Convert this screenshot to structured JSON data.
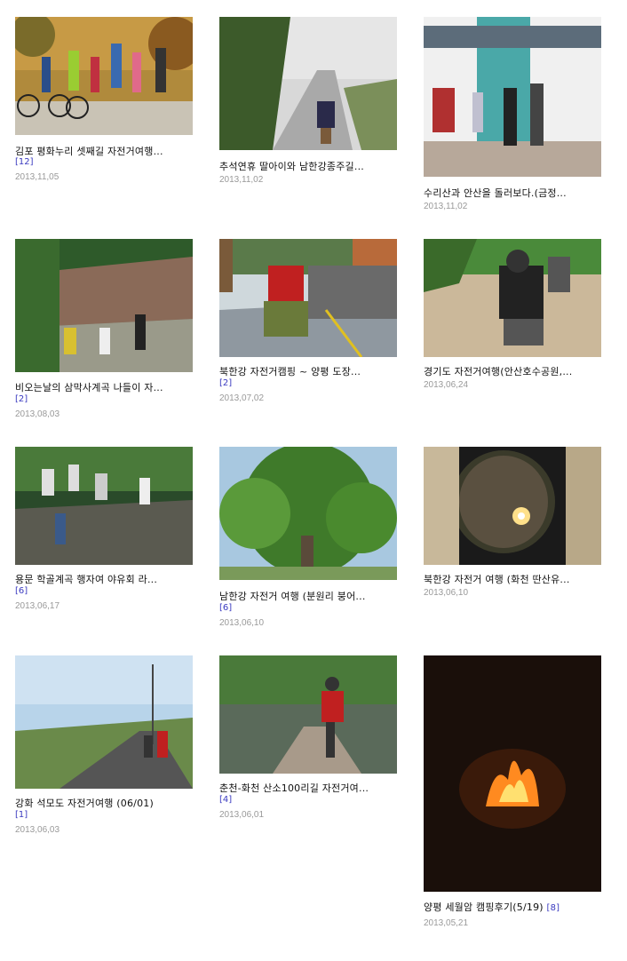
{
  "posts": [
    {
      "title": "김포 평화누리 셋째길 자전거여행...",
      "count": "[12]",
      "date": "2013,11,05"
    },
    {
      "title": "추석연휴 딸아이와 남한강종주길...",
      "count": "",
      "date": "2013,11,02"
    },
    {
      "title": "수리산과 안산을 돌러보다.(금정...",
      "count": "",
      "date": "2013,11,02"
    },
    {
      "title": "비오는날의 삼막사계곡 나들이 자...",
      "count": "[2]",
      "date": "2013,08,03"
    },
    {
      "title": "북한강 자전거캠핑 ~ 양평 도장...",
      "count": "[2]",
      "date": "2013,07,02"
    },
    {
      "title": "경기도 자전거여행(안산호수공원,...",
      "count": "",
      "date": "2013,06,24"
    },
    {
      "title": "용문 학골계곡 행자여 야유회 라...",
      "count": "[6]",
      "date": "2013,06,17"
    },
    {
      "title": "남한강 자전거 여행 (분원리 붕어...",
      "count": "[6]",
      "date": "2013,06,10"
    },
    {
      "title": "북한강 자전거 여행 (화천 딴산유...",
      "count": "",
      "date": "2013,06,10"
    },
    {
      "title": "강화 석모도 자전거여행 (06/01)",
      "count": "[1]",
      "date": "2013,06,03"
    },
    {
      "title": "춘천-화천 산소100리길 자전거여...",
      "count": "[4]",
      "date": "2013,06,01"
    },
    {
      "title": "양평 세월암 캠핑후기(5/19)",
      "count": "[8]",
      "date": "2013,05,21"
    }
  ]
}
